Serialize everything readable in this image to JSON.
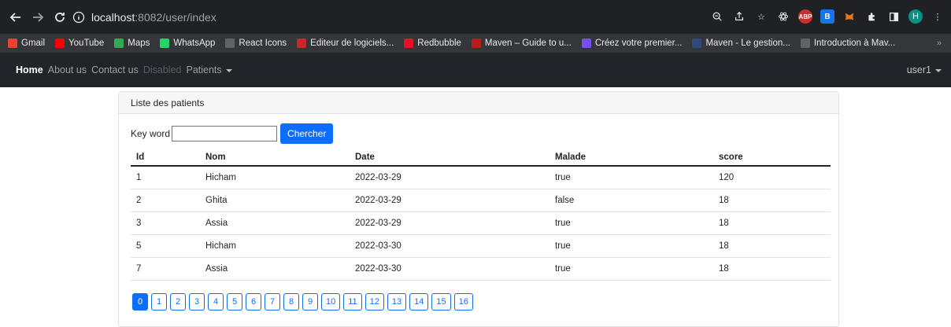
{
  "browser": {
    "url_host": "localhost",
    "url_path": ":8082/user/index",
    "avatar_letter": "H",
    "extensions": [
      "ABP",
      "B"
    ],
    "bookmarks": [
      {
        "label": "Gmail",
        "icon": "gmail-icon",
        "color": "#ea4335"
      },
      {
        "label": "YouTube",
        "icon": "youtube-icon",
        "color": "#ff0000"
      },
      {
        "label": "Maps",
        "icon": "maps-icon",
        "color": "#34a853"
      },
      {
        "label": "WhatsApp",
        "icon": "whatsapp-icon",
        "color": "#25d366"
      },
      {
        "label": "React Icons",
        "icon": "globe-icon",
        "color": "#5f6368"
      },
      {
        "label": "Editeur de logiciels...",
        "icon": "editeur-icon",
        "color": "#c62828"
      },
      {
        "label": "Redbubble",
        "icon": "redbubble-icon",
        "color": "#e41321"
      },
      {
        "label": "Maven – Guide to u...",
        "icon": "maven-icon",
        "color": "#b71c1c"
      },
      {
        "label": "Créez votre premier...",
        "icon": "openclassrooms-icon",
        "color": "#7451eb"
      },
      {
        "label": "Maven - Le gestion...",
        "icon": "maven-gestion-icon",
        "color": "#2c4a7a"
      },
      {
        "label": "Introduction à Mav...",
        "icon": "globe-icon",
        "color": "#5f6368"
      }
    ],
    "bookmarks_more": "»"
  },
  "navbar": {
    "items": [
      {
        "label": "Home",
        "state": "active"
      },
      {
        "label": "About us",
        "state": "normal"
      },
      {
        "label": "Contact us",
        "state": "normal"
      },
      {
        "label": "Disabled",
        "state": "disabled"
      },
      {
        "label": "Patients",
        "state": "dropdown"
      }
    ],
    "user": "user1"
  },
  "card": {
    "title": "Liste des patients",
    "search_label": "Key word",
    "search_value": "",
    "search_button": "Chercher"
  },
  "table": {
    "headers": [
      "Id",
      "Nom",
      "Date",
      "Malade",
      "score"
    ],
    "rows": [
      [
        "1",
        "Hicham",
        "2022-03-29",
        "true",
        "120"
      ],
      [
        "2",
        "Ghita",
        "2022-03-29",
        "false",
        "18"
      ],
      [
        "3",
        "Assia",
        "2022-03-29",
        "true",
        "18"
      ],
      [
        "5",
        "Hicham",
        "2022-03-30",
        "true",
        "18"
      ],
      [
        "7",
        "Assia",
        "2022-03-30",
        "true",
        "18"
      ]
    ]
  },
  "pagination": {
    "pages": [
      "0",
      "1",
      "2",
      "3",
      "4",
      "5",
      "6",
      "7",
      "8",
      "9",
      "10",
      "11",
      "12",
      "13",
      "14",
      "15",
      "16"
    ],
    "active": "0"
  },
  "colors": {
    "primary": "#0d6efd",
    "navbar_bg": "#212529"
  }
}
